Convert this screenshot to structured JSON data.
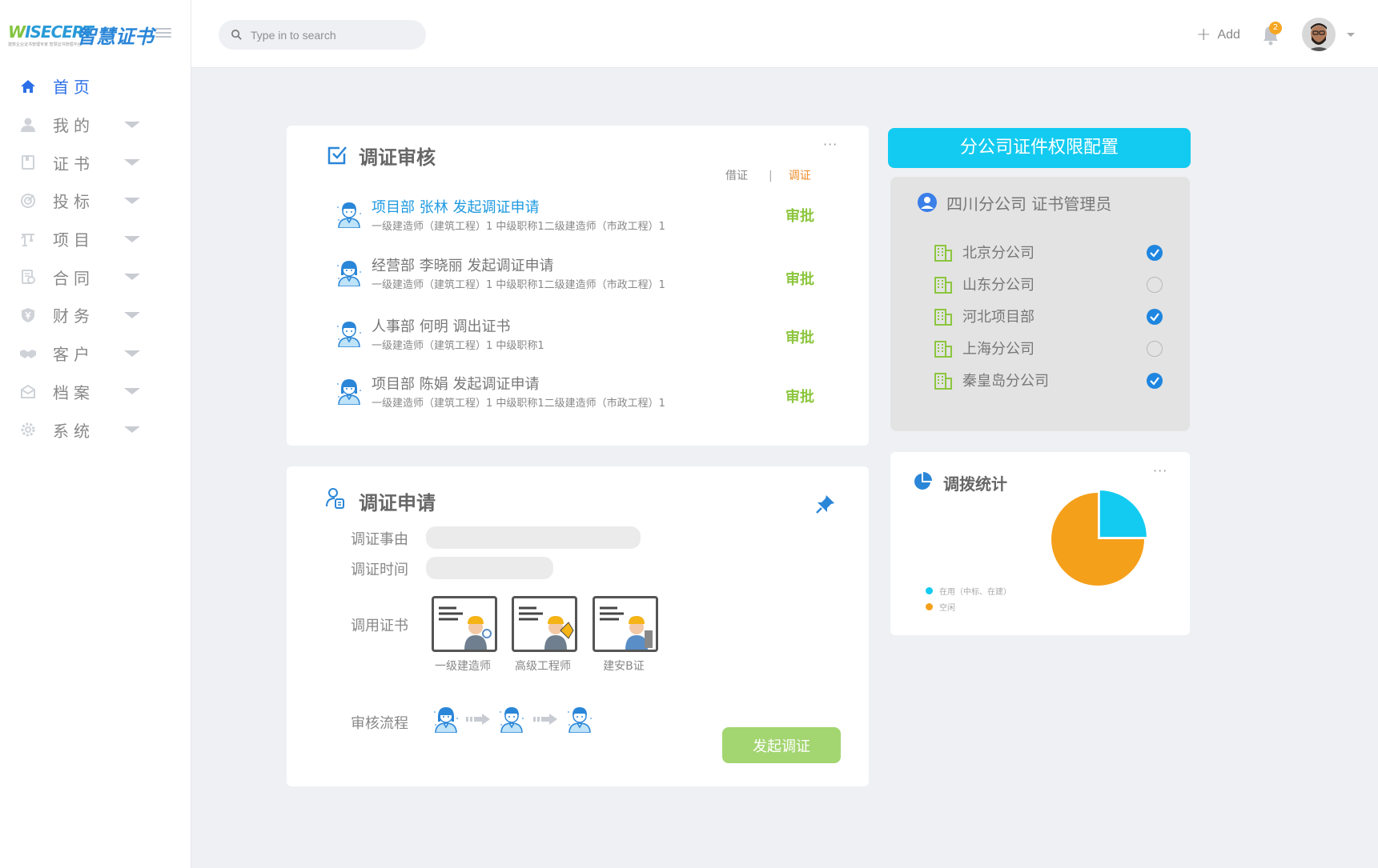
{
  "brand": {
    "en_prefix": "W",
    "en_rest": "ISECERT",
    "cn": "智慧证书",
    "tagline": "建筑企业证书管理专家 智慧证书管理平台"
  },
  "nav": [
    {
      "label": "首页",
      "icon": "home-icon",
      "active": true
    },
    {
      "label": "我的",
      "icon": "user-icon"
    },
    {
      "label": "证书",
      "icon": "book-icon"
    },
    {
      "label": "投标",
      "icon": "target-icon"
    },
    {
      "label": "项目",
      "icon": "crane-icon"
    },
    {
      "label": "合同",
      "icon": "contract-icon"
    },
    {
      "label": "财务",
      "icon": "shield-yen-icon"
    },
    {
      "label": "客户",
      "icon": "handshake-icon"
    },
    {
      "label": "档案",
      "icon": "archive-icon"
    },
    {
      "label": "系统",
      "icon": "gear-icon"
    }
  ],
  "header": {
    "search_placeholder": "Type in to search",
    "add_label": "Add",
    "notification_count": "2"
  },
  "review": {
    "title": "调证审核",
    "more": "···",
    "tab_borrow": "借证",
    "tab_sep": "|",
    "tab_transfer": "调证",
    "approve_label": "审批",
    "requests": [
      {
        "title": "项目部 张林 发起调证申请",
        "sub": "一级建造师（建筑工程）1 中级职称1二级建造师（市政工程）1",
        "highlight": true,
        "gender": "m"
      },
      {
        "title": "经营部 李晓丽 发起调证申请",
        "sub": "一级建造师（建筑工程）1 中级职称1二级建造师（市政工程）1",
        "highlight": false,
        "gender": "f"
      },
      {
        "title": "人事部 何明 调出证书",
        "sub": "一级建造师（建筑工程）1 中级职称1",
        "highlight": false,
        "gender": "m"
      },
      {
        "title": "项目部 陈娟 发起调证申请",
        "sub": "一级建造师（建筑工程）1 中级职称1二级建造师（市政工程）1",
        "highlight": false,
        "gender": "f"
      }
    ]
  },
  "apply": {
    "title": "调证申请",
    "reason_label": "调证事由",
    "time_label": "调证时间",
    "cert_label": "调用证书",
    "flow_label": "审核流程",
    "certs": [
      "一级建造师",
      "高级工程师",
      "建安B证"
    ],
    "submit_label": "发起调证"
  },
  "config": {
    "title": "分公司证件权限配置",
    "user": "四川分公司   证书管理员",
    "branches": [
      {
        "name": "北京分公司",
        "checked": true
      },
      {
        "name": "山东分公司",
        "checked": false
      },
      {
        "name": "河北项目部",
        "checked": true
      },
      {
        "name": "上海分公司",
        "checked": false
      },
      {
        "name": "秦皇岛分公司",
        "checked": true
      }
    ]
  },
  "stats": {
    "title": "调拨统计",
    "more": "···",
    "legend": [
      {
        "label": "在用（中标、在建）",
        "color": "#13cbf0"
      },
      {
        "label": "空闲",
        "color": "#f5a01b"
      }
    ]
  },
  "chart_data": {
    "type": "pie",
    "categories": [
      "在用（中标、在建）",
      "空闲"
    ],
    "values": [
      25,
      75
    ],
    "colors": [
      "#13cbf0",
      "#f5a01b"
    ],
    "title": "调拨统计",
    "legend_position": "left"
  },
  "colors": {
    "accent": "#2d6fe8",
    "link": "#1f9ae0",
    "approve": "#8cc63e",
    "cyan": "#13cbf0",
    "orange": "#f08a24"
  }
}
